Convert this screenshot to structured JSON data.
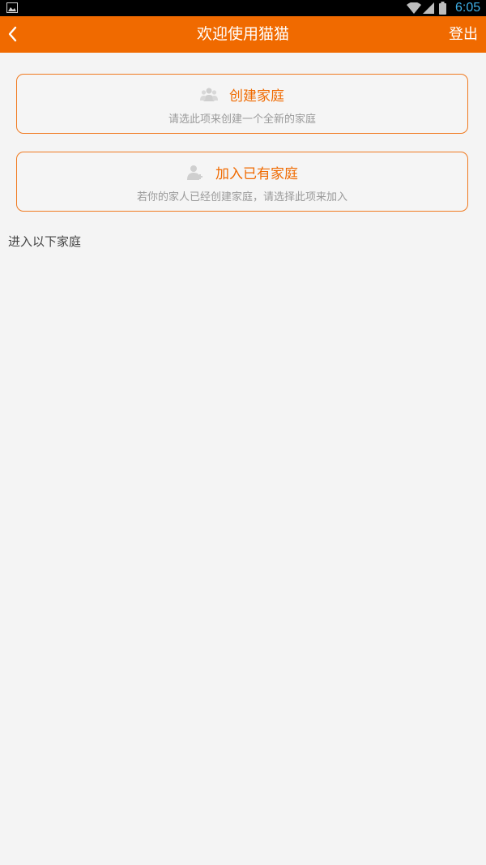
{
  "status_bar": {
    "time": "6:05",
    "icons": [
      "gallery-icon",
      "wifi-icon",
      "signal-icon",
      "battery-icon"
    ],
    "clock_color": "#3fb0e8"
  },
  "app_bar": {
    "title": "欢迎使用猫猫",
    "logout_label": "登出",
    "back_icon": "chevron-left-icon",
    "color": "#f06a00"
  },
  "options": [
    {
      "icon": "group-icon",
      "title": "创建家庭",
      "subtitle": "请选此项来创建一个全新的家庭"
    },
    {
      "icon": "add-person-icon",
      "title": "加入已有家庭",
      "subtitle": "若你的家人已经创建家庭，请选择此项来加入"
    }
  ],
  "section": {
    "label": "进入以下家庭"
  }
}
